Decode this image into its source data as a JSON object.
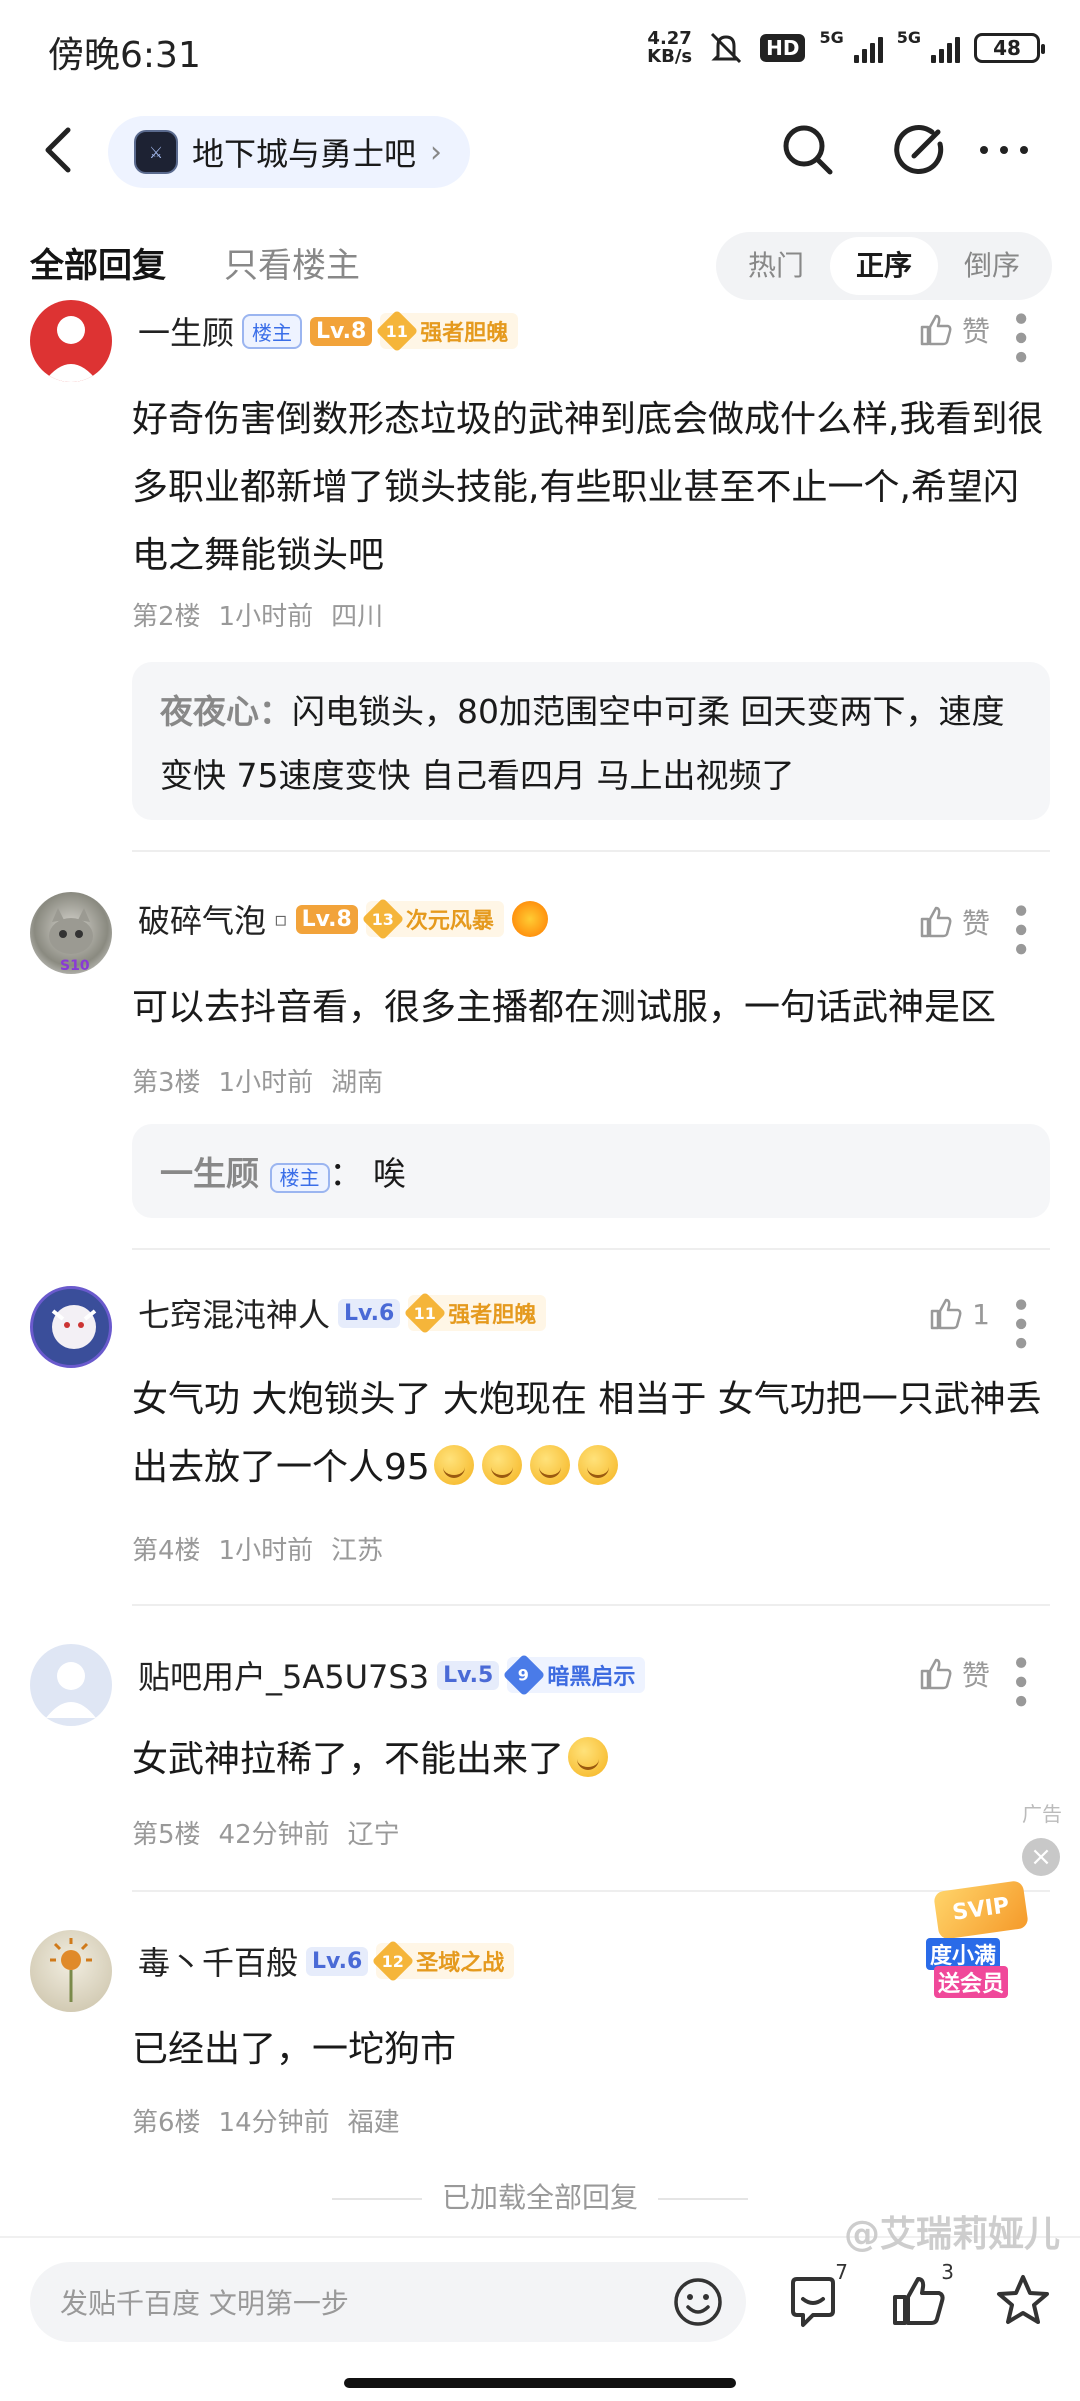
{
  "status": {
    "time": "傍晚6:31",
    "net_speed": "4.27",
    "net_unit": "KB/s",
    "hd": "HD",
    "sig1": "5G",
    "sig2": "5G",
    "battery": "48"
  },
  "header": {
    "forum_name": "地下城与勇士吧"
  },
  "tabs": {
    "all": "全部回复",
    "owner_only": "只看楼主",
    "sort": [
      "热门",
      "正序",
      "倒序"
    ],
    "sort_active": "正序"
  },
  "comments": [
    {
      "user": "一生顾",
      "owner_badge": "楼主",
      "level": "Lv.8",
      "honor_num": "11",
      "honor": "强者胆魄",
      "like": "赞",
      "text": "好奇伤害倒数形态垃圾的武神到底会做成什么样,我看到很多职业都新增了锁头技能,有些职业甚至不止一个,希望闪电之舞能锁头吧",
      "floor": "第2楼",
      "time": "1小时前",
      "loc": "四川",
      "reply_name": "夜夜心：",
      "reply_text": "闪电锁头，80加范围空中可柔 回天变两下，速度变快 75速度变快 自己看四月 马上出视频了"
    },
    {
      "user": "破碎气泡",
      "level": "Lv.8",
      "honor_num": "13",
      "honor": "次元风暴",
      "like": "赞",
      "text": "可以去抖音看，很多主播都在测试服，一句话武神是区",
      "floor": "第3楼",
      "time": "1小时前",
      "loc": "湖南",
      "reply_name": "一生顾",
      "reply_badge": "楼主",
      "reply_text": "：  唉"
    },
    {
      "user": "七窍混沌神人",
      "level": "Lv.6",
      "honor_num": "11",
      "honor": "强者胆魄",
      "like": "1",
      "text": "女气功 大炮锁头了 大炮现在 相当于 女气功把一只武神丢出去放了一个人95",
      "floor": "第4楼",
      "time": "1小时前",
      "loc": "江苏"
    },
    {
      "user": "贴吧用户_5A5U7S3",
      "level": "Lv.5",
      "honor_num": "9",
      "honor": "暗黑启示",
      "like": "赞",
      "text": "女武神拉稀了，不能出来了",
      "floor": "第5楼",
      "time": "42分钟前",
      "loc": "辽宁"
    },
    {
      "user": "毒丶千百般",
      "level": "Lv.6",
      "honor_num": "12",
      "honor": "圣域之战",
      "text": "已经出了，一坨狗市",
      "floor": "第6楼",
      "time": "14分钟前",
      "loc": "福建"
    }
  ],
  "loaded_all": "已加载全部回复",
  "ad": {
    "label": "广告",
    "svip": "SVIP",
    "line1": "度小满",
    "line2": "送会员"
  },
  "bottom": {
    "placeholder": "发贴千百度 文明第一步",
    "comment_count": "7",
    "like_count": "3"
  },
  "watermark": "@艾瑞莉娅儿"
}
